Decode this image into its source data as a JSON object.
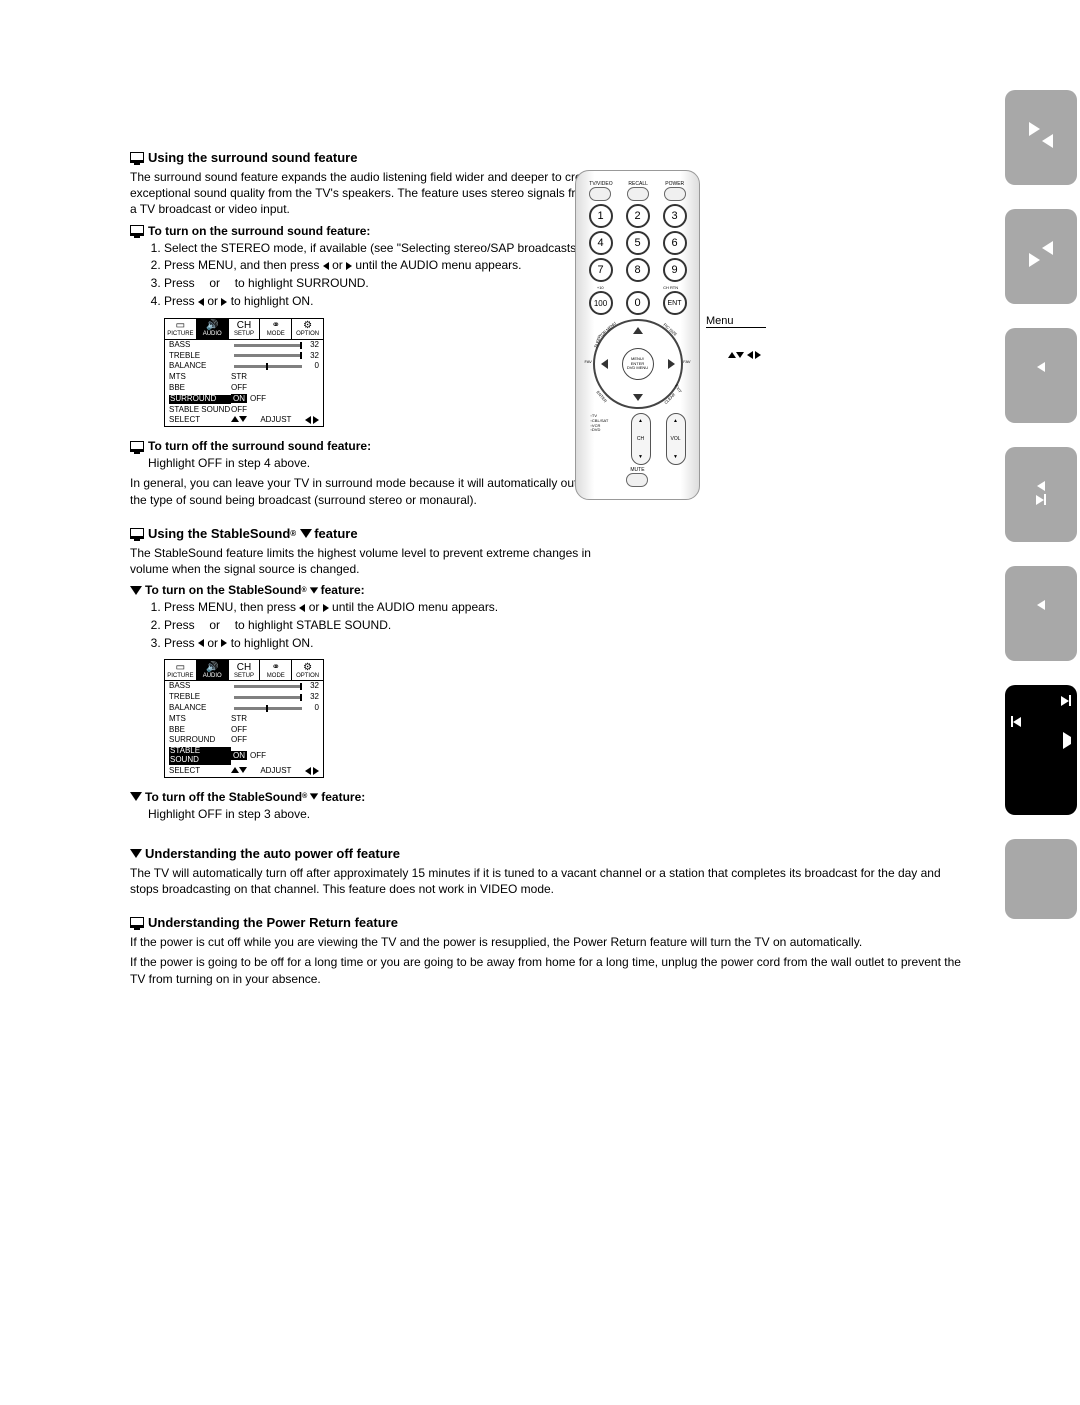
{
  "sections": {
    "surround": {
      "title": "Using the surround sound feature",
      "intro": "The surround sound feature expands the audio listening field wider and deeper to create exceptional sound quality from the TV's speakers. The feature uses stereo signals from a TV broadcast or video input.",
      "on_title": "To turn on the surround sound feature:",
      "steps": {
        "s1": "Select the STEREO mode, if available (see \"Selecting stereo/SAP broadcasts\" on page 31.)",
        "s2a": "Press MENU, and then press ",
        "s2b": " or ",
        "s2c": " until the AUDIO menu appears.",
        "s3a": "Press ",
        "s3b": " or ",
        "s3c": " to highlight SURROUND.",
        "s4a": "Press ",
        "s4b": " or ",
        "s4c": " to highlight ON."
      },
      "off_title": "To turn off the surround sound feature:",
      "off_step": "Highlight OFF in step 4 above.",
      "note": "In general, you can leave your TV in surround mode because it will automatically output the type of sound being broadcast (surround stereo or monaural)."
    },
    "stable": {
      "title": "Using the StableSound",
      "title2": " feature",
      "intro": "The StableSound feature limits the highest volume level to prevent extreme changes in volume when the signal source is changed.",
      "on_title_a": "To turn on the StableSound",
      "on_title_b": " feature:",
      "steps": {
        "s1a": "Press MENU, then press ",
        "s1b": " or ",
        "s1c": " until the AUDIO menu appears.",
        "s2a": "Press ",
        "s2b": " or ",
        "s2c": " to highlight STABLE SOUND.",
        "s3a": "Press ",
        "s3b": " or ",
        "s3c": " to highlight ON."
      },
      "off_title_a": "To turn off the StableSound",
      "off_title_b": " feature:",
      "off_step": "Highlight OFF in step 3 above."
    },
    "auto": {
      "title": "Understanding the auto power off feature",
      "body": "The TV will automatically turn off after approximately 15 minutes if it is tuned to a vacant channel or a station that completes its broadcast for the day and stops broadcasting on that channel. This feature does not work in VIDEO mode."
    },
    "power_return": {
      "title": "Understanding the Power Return feature",
      "p1": "If the power is cut off while you are viewing the TV and the power is resupplied, the Power Return feature will turn the TV on automatically.",
      "p2": "If the power is going to be off for a long time or you are going to be away from home for a long time, unplug the power cord from the wall outlet to prevent the TV from turning on in your absence."
    }
  },
  "menu": {
    "tabs": {
      "picture": "PICTURE",
      "audio": "AUDIO",
      "setup": "SETUP",
      "mode": "MODE",
      "option": "OPTION"
    },
    "rows": {
      "bass": "BASS",
      "treble": "TREBLE",
      "balance": "BALANCE",
      "mts": "MTS",
      "bbe": "BBE",
      "surround": "SURROUND",
      "stable": "STABLE SOUND",
      "select": "SELECT",
      "adjust": "ADJUST"
    },
    "vals": {
      "bass": "32",
      "treble": "32",
      "balance": "0",
      "mts": "STR",
      "bbe": "OFF",
      "on": "ON",
      "off": "OFF"
    }
  },
  "remote": {
    "top": {
      "tvvideo": "TV/VIDEO",
      "recall": "RECALL",
      "power": "POWER"
    },
    "nums": {
      "n1": "1",
      "n2": "2",
      "n3": "3",
      "n4": "4",
      "n5": "5",
      "n6": "6",
      "n7": "7",
      "n8": "8",
      "n9": "9",
      "n100": "100",
      "n0": "0",
      "ent": "ENT",
      "plus10": "+10",
      "chrtn": "CH RTN"
    },
    "dpad": {
      "menu": "MENU/",
      "enter": "ENTER",
      "dvdmenu": "DVD MENU",
      "topmenu": "TOP MENU",
      "sleep": "SLEEP",
      "picsize": "PIC SIZE",
      "exit": "EXIT",
      "clear": "CLEAR",
      "enterbtm": "ENTER",
      "fav": "FAV"
    },
    "rockers": {
      "ch": "CH",
      "vol": "VOL"
    },
    "mode": {
      "tv": "TV",
      "cbl": "CBL/SAT",
      "vcr": "VCR",
      "dvd": "DVD"
    },
    "mute": "MUTE"
  },
  "labels": {
    "menu": "Menu"
  }
}
